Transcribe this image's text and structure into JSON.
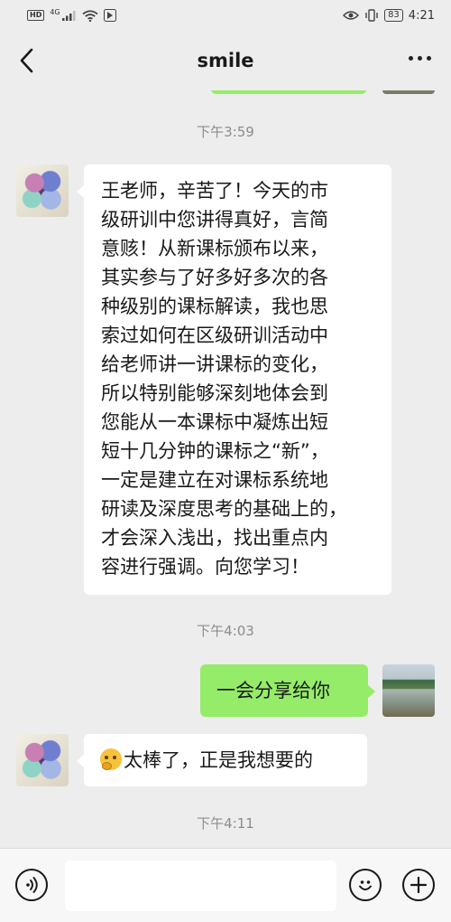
{
  "status_bar": {
    "left_badge": "HD",
    "network": "4G",
    "battery": "83",
    "time": "4:21"
  },
  "header": {
    "title": "smile",
    "back_icon": "chevron-left-icon",
    "more_icon": "more-dots-icon"
  },
  "messages": [
    {
      "type": "time",
      "text": "下午3:59"
    },
    {
      "type": "incoming",
      "avatar": "flower-avatar",
      "lines": [
        "王老师，辛苦了！今天的市",
        "级研训中您讲得真好，言简",
        "意赅！从新课标颁布以来，",
        "其实参与了好多好多次的各",
        "种级别的课标解读，我也思",
        "索过如何在区级研训活动中",
        "给老师讲一讲课标的变化，",
        "所以特别能够深刻地体会到",
        "您能从一本课标中凝炼出短",
        "短十几分钟的课标之“新”，",
        "一定是建立在对课标系统地",
        "研读及深度思考的基础上的，",
        "才会深入浅出，找出重点内",
        "容进行强调。向您学习！"
      ]
    },
    {
      "type": "time",
      "text": "下午4:03"
    },
    {
      "type": "outgoing",
      "avatar": "lake-avatar",
      "text": "一会分享给你"
    },
    {
      "type": "incoming",
      "avatar": "flower-avatar",
      "emoji": "thinking-face-emoji",
      "text": "太棒了，正是我想要的"
    },
    {
      "type": "time",
      "text": "下午4:11"
    }
  ],
  "input_bar": {
    "voice_icon": "voice-icon",
    "emoji_icon": "emoji-icon",
    "plus_icon": "plus-icon",
    "input_value": ""
  }
}
